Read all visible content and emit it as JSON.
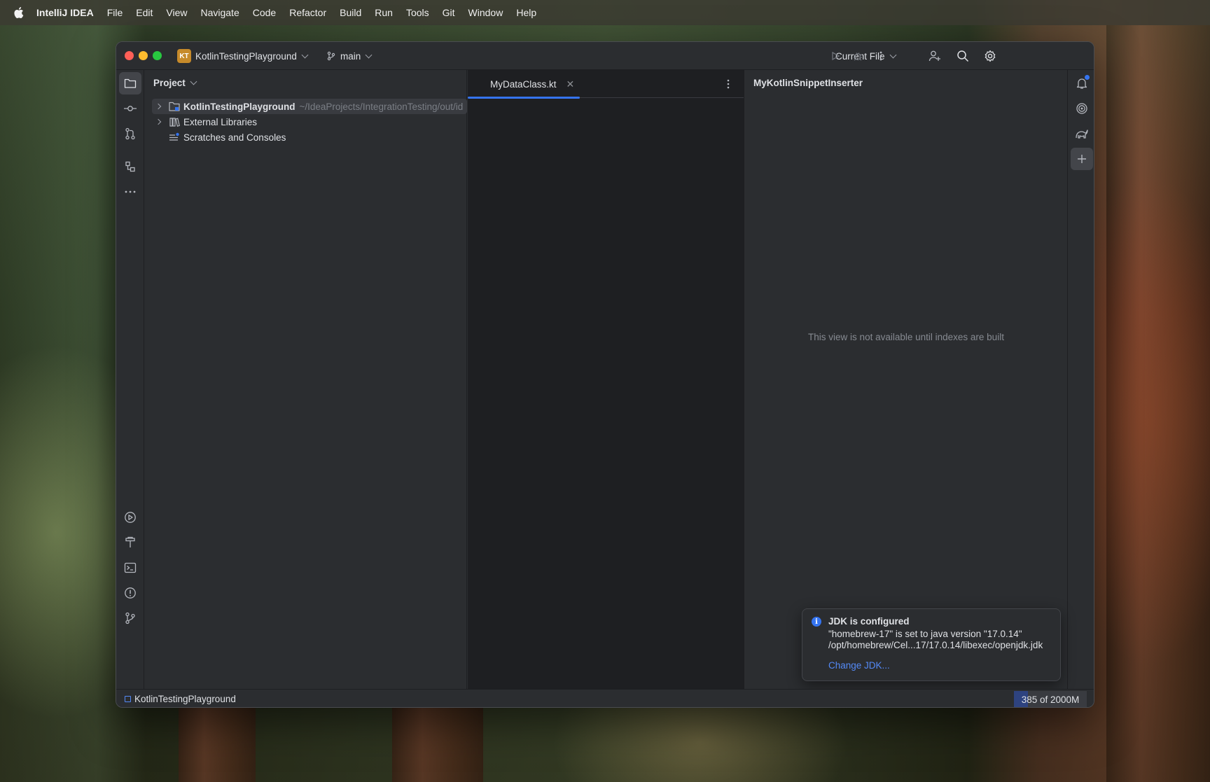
{
  "menubar": {
    "app_name": "IntelliJ IDEA",
    "items": [
      "File",
      "Edit",
      "View",
      "Navigate",
      "Code",
      "Refactor",
      "Build",
      "Run",
      "Tools",
      "Git",
      "Window",
      "Help"
    ]
  },
  "titlebar": {
    "project_badge": "KT",
    "project_name": "KotlinTestingPlayground",
    "branch": "main",
    "run_config": "Current File"
  },
  "project_panel": {
    "title": "Project",
    "tree": [
      {
        "label": "KotlinTestingPlayground",
        "path": "~/IdeaProjects/IntegrationTesting/out/id",
        "expandable": true,
        "selected": true,
        "bold": true
      },
      {
        "label": "External Libraries",
        "expandable": true
      },
      {
        "label": "Scratches and Consoles",
        "expandable": false
      }
    ]
  },
  "editor": {
    "tabs": [
      {
        "label": "MyDataClass.kt",
        "active": true
      }
    ]
  },
  "right_panel": {
    "title": "MyKotlinSnippetInserter",
    "empty_text": "This view is not available until indexes are built"
  },
  "notification": {
    "title": "JDK is configured",
    "line1": "\"homebrew-17\" is set to java version \"17.0.14\"",
    "line2": "/opt/homebrew/Cel...17/17.0.14/libexec/openjdk.jdk",
    "link": "Change JDK..."
  },
  "statusbar": {
    "breadcrumb": "KotlinTestingPlayground",
    "memory_text": "385 of 2000M",
    "memory_used_fraction": 0.19
  },
  "colors": {
    "accent": "#3574f0",
    "link": "#548af7",
    "panel_bg": "#2b2d30",
    "editor_bg": "#1e1f22"
  }
}
